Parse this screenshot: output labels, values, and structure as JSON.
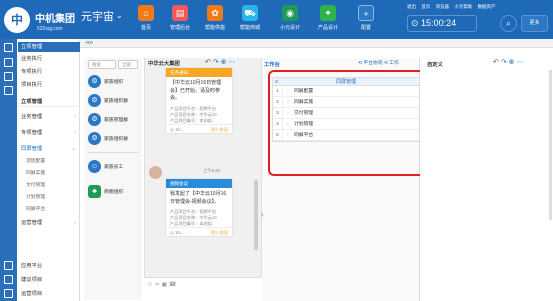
{
  "header": {
    "logo": "中",
    "brand": "中机集团",
    "product": "元宇宙",
    "domain": "520sqj.com",
    "nav": [
      {
        "label": "首页",
        "icon": "home-icon",
        "color": "#f07a1a"
      },
      {
        "label": "管理后台",
        "icon": "admin-icon",
        "color": "#f05a5a"
      },
      {
        "label": "帮能供能",
        "icon": "gear-icon",
        "color": "#f07a1a"
      },
      {
        "label": "帮能商城",
        "icon": "cart-icon",
        "color": "#2ab5e8"
      },
      {
        "label": "小元设计",
        "icon": "design-icon",
        "color": "#1e9b5a"
      },
      {
        "label": "产品设计",
        "icon": "product-icon",
        "color": "#2db34a"
      },
      {
        "label": "配置",
        "icon": "plus-icon",
        "color": "#2a78c6"
      }
    ],
    "top_links": [
      "退出",
      "首页",
      "浏览器",
      "小元帮助",
      "数据资产"
    ],
    "clock": "15:00:24",
    "more": "更多"
  },
  "sidebar": {
    "items": [
      {
        "label": "立项管理",
        "active": true
      },
      {
        "label": "业务执行"
      },
      {
        "label": "专项执行"
      },
      {
        "label": "项目执行"
      },
      {
        "label": "立项管理",
        "group": true
      },
      {
        "label": "业务管理"
      },
      {
        "label": "专项管理"
      },
      {
        "label": "同屏管理",
        "active2": true
      },
      {
        "label": "流程配置",
        "sub": true
      },
      {
        "label": "同屏实施",
        "sub": true
      },
      {
        "label": "文付管理",
        "sub": true
      },
      {
        "label": "计划管理",
        "sub": true
      },
      {
        "label": "同屏平台",
        "sub": true
      },
      {
        "label": "运营管理"
      }
    ],
    "bottom": [
      "应用平台",
      "建议项目",
      "运营项目"
    ]
  },
  "tabbar": {
    "label": "⊲⊳"
  },
  "contacts": {
    "search_placeholder": "搜索",
    "filter": "全部",
    "users": [
      {
        "name": "家族组织",
        "color": "#2a78c6"
      },
      {
        "name": "家族组织群",
        "color": "#2a78c6"
      },
      {
        "name": "家族管理群",
        "color": "#2a78c6"
      },
      {
        "name": "家族组织群",
        "color": "#2a78c6"
      },
      {
        "name": "家族员工",
        "color": "#2a78c6"
      },
      {
        "name": "商圈组织",
        "color": "#1e9b5a"
      }
    ]
  },
  "chat": {
    "title": "中华云大集团",
    "card1": {
      "header": "任务通知",
      "body": "【中华云10月16日管理会】已开始。请及时参会。",
      "meta": [
        "产品项目平台：招牌平台",
        "产品项目名称：中华云10",
        "产品项目编号：本创组"
      ],
      "footer": "◎ 10-...",
      "action": "进入会议"
    },
    "time": "上午9:26",
    "card2": {
      "header": "视频会议",
      "body": "我发起了【中华云10月16日管理会-视频会议】。",
      "meta": [
        "产品项目平台：招牌平台",
        "产品项目名称：中华云10",
        "产品项目编号：本创组"
      ],
      "footer": "◎ 10-...",
      "action": "进入会议"
    },
    "bar": "☺ ✂ ▣ ☎"
  },
  "work": {
    "title": "工作台",
    "ops": "⟲ 平台协同  ⟲ 工作",
    "tree_header": "同屏管理",
    "rows": [
      {
        "n": "1",
        "label": "同屏配置"
      },
      {
        "n": "2",
        "label": "同屏实施"
      },
      {
        "n": "3",
        "label": "交付管理"
      },
      {
        "n": "4",
        "label": "计划管理"
      },
      {
        "n": "5",
        "label": "同屏平台"
      }
    ]
  },
  "custom": {
    "title": "自定义"
  }
}
